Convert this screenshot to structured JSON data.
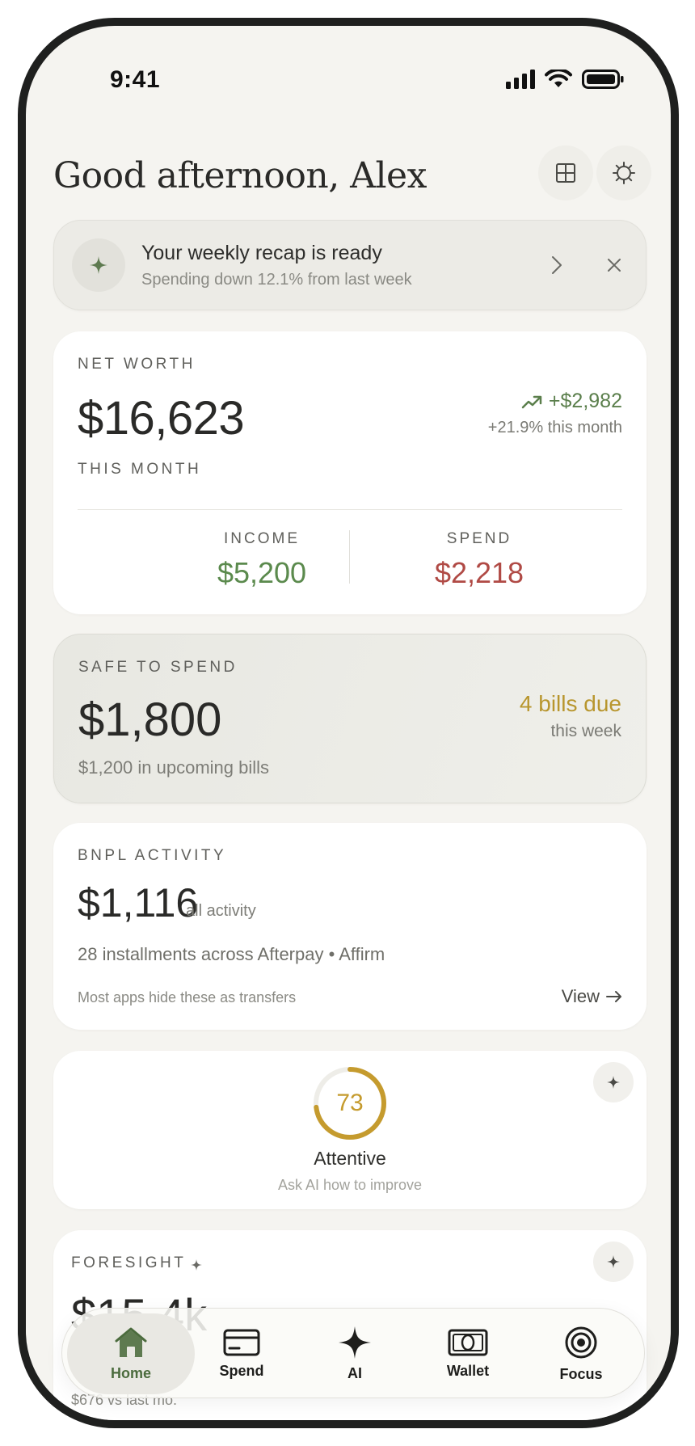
{
  "status": {
    "time": "9:41"
  },
  "header": {
    "greeting": "Good afternoon, Alex"
  },
  "recap": {
    "title": "Your weekly recap is ready",
    "subtitle": "Spending down 12.1% from last week"
  },
  "net_worth": {
    "label": "NET WORTH",
    "amount": "$16,623",
    "change": "+$2,982",
    "change_pct": "+21.9% this month",
    "month_label": "THIS MONTH",
    "income_label": "INCOME",
    "income_value": "$5,200",
    "spend_label": "SPEND",
    "spend_value": "$2,218"
  },
  "safe_to_spend": {
    "label": "SAFE TO SPEND",
    "amount": "$1,800",
    "subtitle": "$1,200 in upcoming bills",
    "bills_due": "4 bills due",
    "bills_when": "this week"
  },
  "bnpl": {
    "label": "BNPL ACTIVITY",
    "amount": "$1,116",
    "scope": "all activity",
    "detail": "28 installments across Afterpay • Affirm",
    "note": "Most apps hide these as transfers",
    "view_label": "View"
  },
  "score": {
    "value": "73",
    "fraction": 0.73,
    "title": "Attentive",
    "subtitle": "Ask AI how to improve"
  },
  "foresight": {
    "label": "FORESIGHT",
    "amount": "$15.4k",
    "subtitle": "$676 vs last mo."
  },
  "tabs": [
    {
      "label": "Home",
      "icon": "home-icon"
    },
    {
      "label": "Spend",
      "icon": "card-icon"
    },
    {
      "label": "AI",
      "icon": "sparkle-icon"
    },
    {
      "label": "Wallet",
      "icon": "wallet-icon"
    },
    {
      "label": "Focus",
      "icon": "target-icon"
    }
  ],
  "colors": {
    "background": "#f5f4f0",
    "positive": "#5b7f4c",
    "negative": "#b04a45",
    "accent_gold": "#c59b2e",
    "active_tab": "#4b6b3d"
  }
}
